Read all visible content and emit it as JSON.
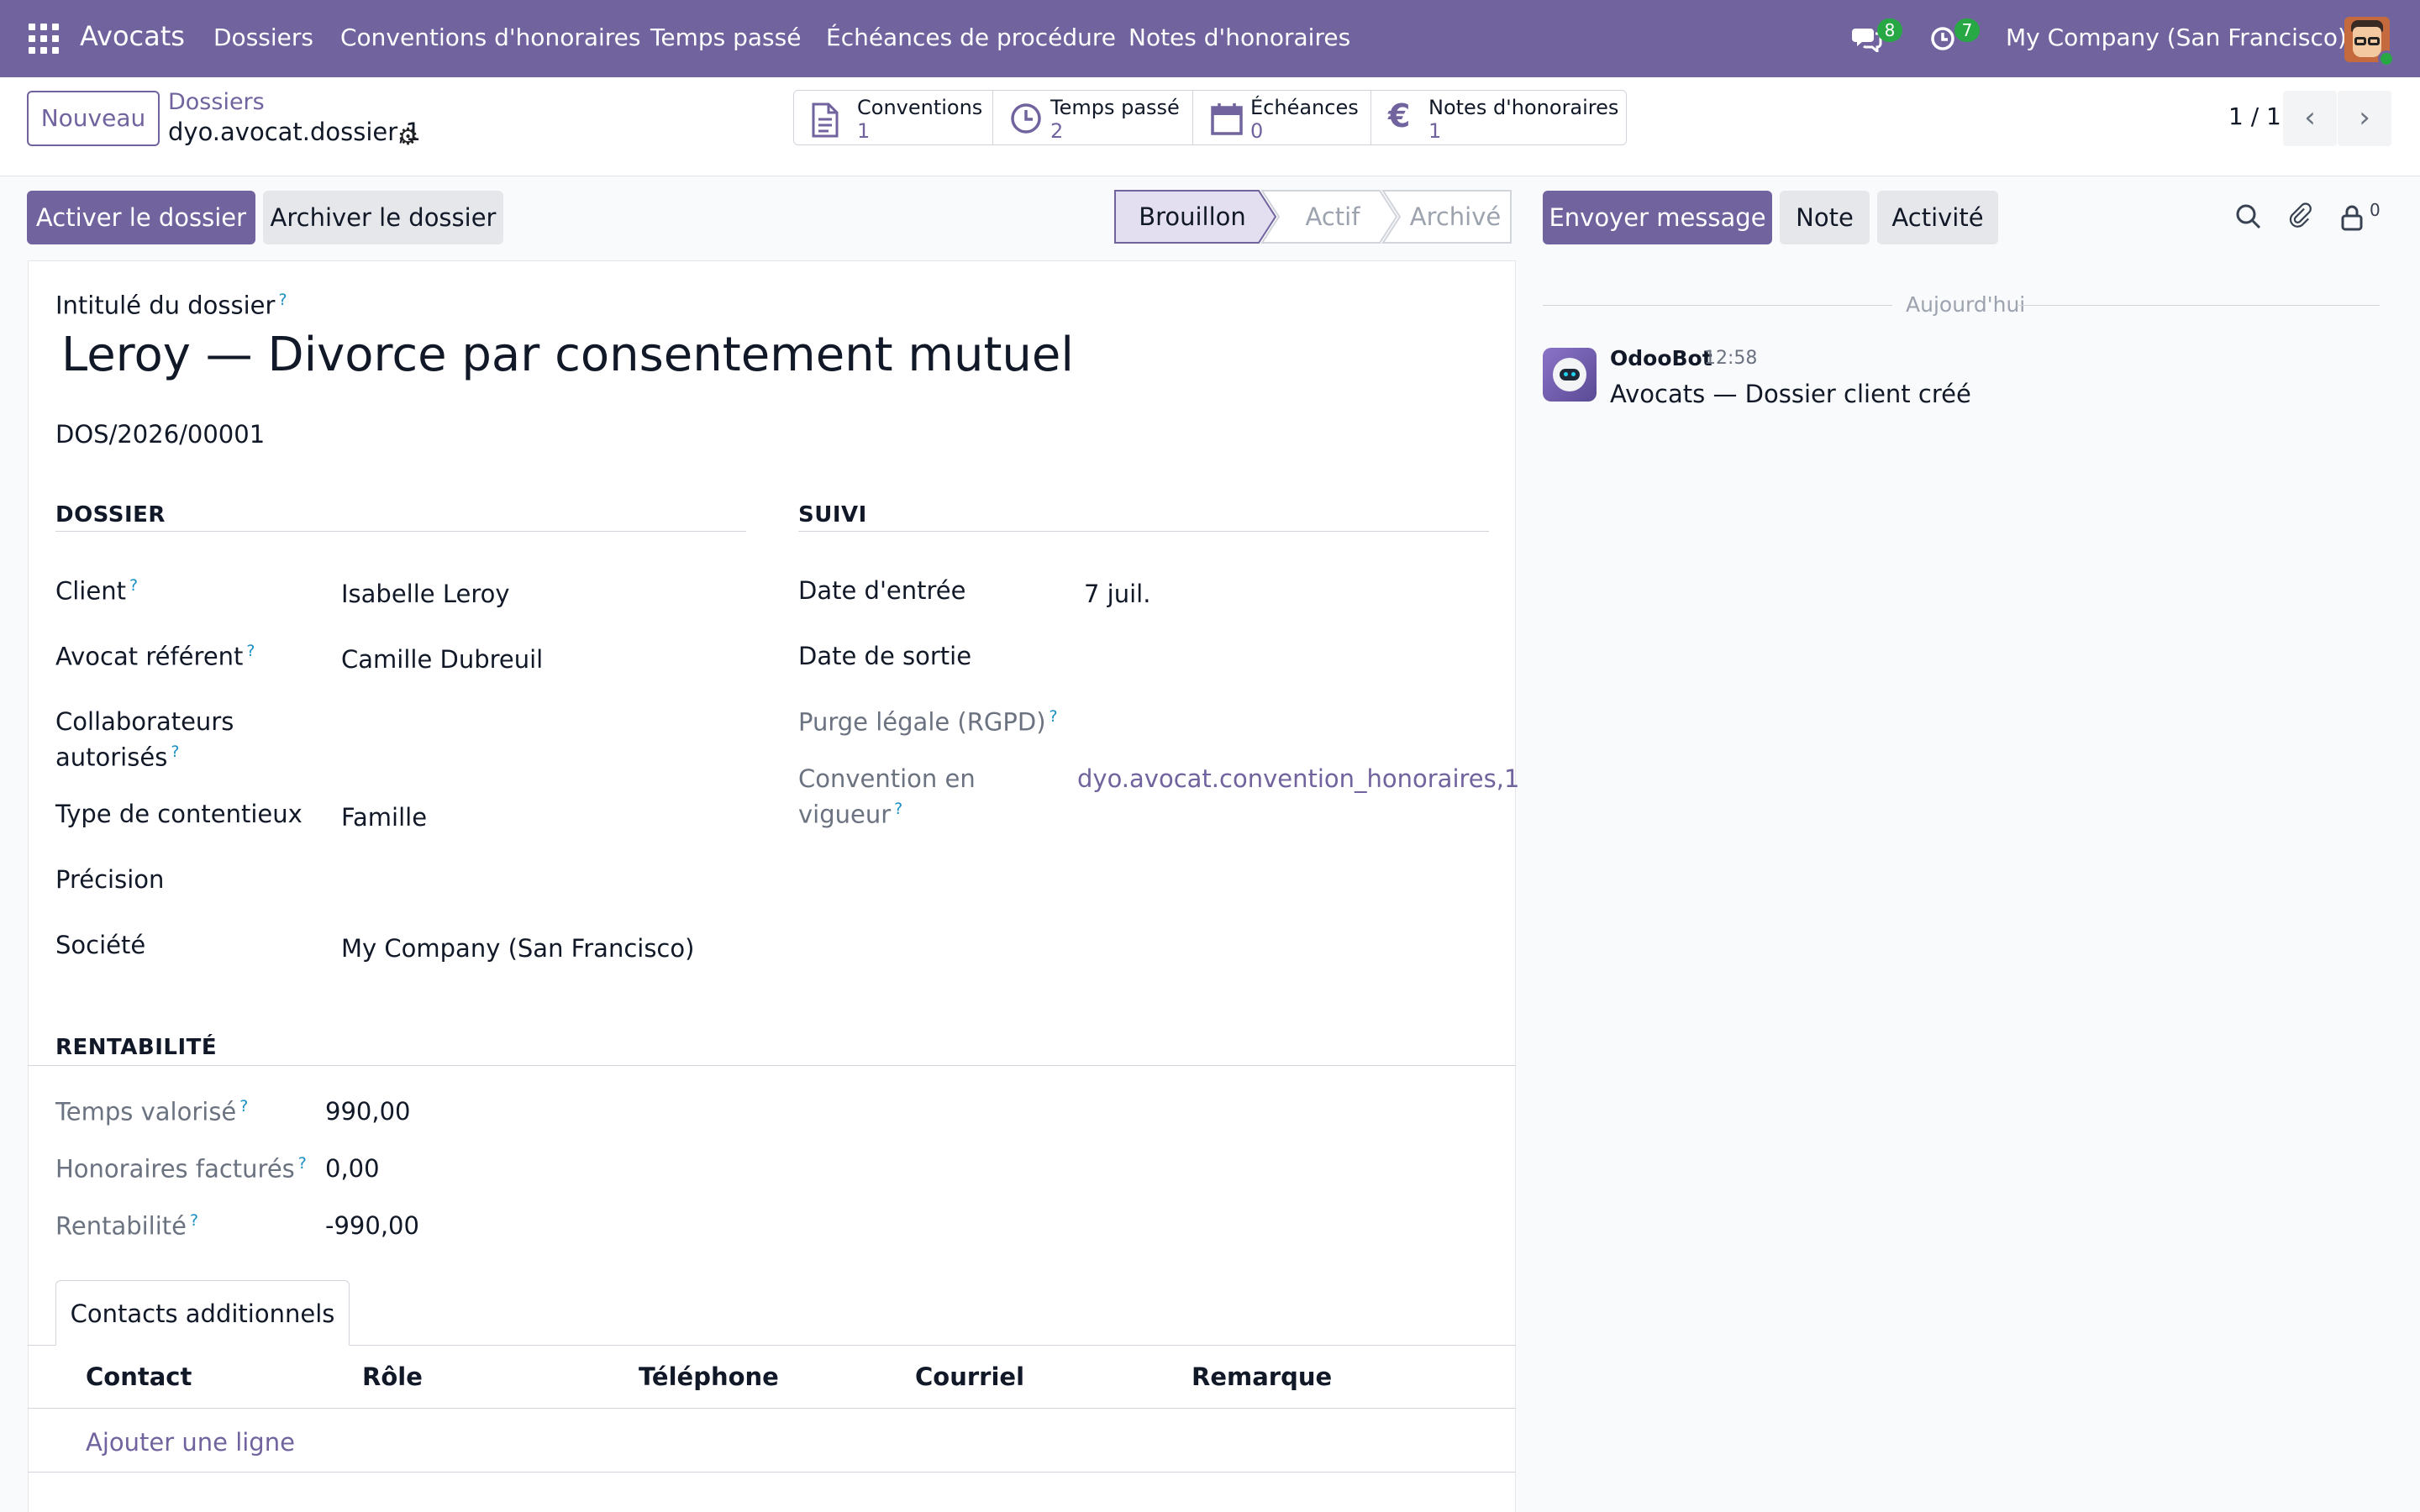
{
  "navbar": {
    "brand": "Avocats",
    "menu": [
      "Dossiers",
      "Conventions d'honoraires",
      "Temps passé",
      "Échéances de procédure",
      "Notes d'honoraires"
    ],
    "messages_badge": "8",
    "activities_badge": "7",
    "company": "My Company (San Francisco)"
  },
  "control": {
    "new_button": "Nouveau",
    "breadcrumb_parent": "Dossiers",
    "breadcrumb_current": "dyo.avocat.dossier,1",
    "smart_buttons": [
      {
        "label": "Conventions",
        "count": "1",
        "icon": "file-icon"
      },
      {
        "label": "Temps passé",
        "count": "2",
        "icon": "clock-icon"
      },
      {
        "label": "Échéances",
        "count": "0",
        "icon": "calendar-icon"
      },
      {
        "label": "Notes d'honoraires",
        "count": "1",
        "icon": "euro-icon"
      }
    ],
    "pager": "1 / 1"
  },
  "statusbar": {
    "activate_button": "Activer le dossier",
    "archive_button": "Archiver le dossier",
    "stages": [
      "Brouillon",
      "Actif",
      "Archivé"
    ],
    "current_stage": "Brouillon"
  },
  "form": {
    "name_label": "Intitulé du dossier",
    "name": "Leroy — Divorce par consentement mutuel",
    "reference": "DOS/2026/00001",
    "dossier_section": "DOSSIER",
    "suivi_section": "SUIVI",
    "client_label": "Client",
    "client": "Isabelle Leroy",
    "lawyer_label": "Avocat référent",
    "lawyer": "Camille Dubreuil",
    "collaborators_label_1": "Collaborateurs",
    "collaborators_label_2": "autorisés",
    "type_label": "Type de contentieux",
    "type": "Famille",
    "precision_label": "Précision",
    "company_label": "Société",
    "company": "My Company (San Francisco)",
    "entry_date_label": "Date d'entrée",
    "entry_date": "7 juil.",
    "exit_date_label": "Date de sortie",
    "purge_label": "Purge légale (RGPD)",
    "convention_label_1": "Convention en",
    "convention_label_2": "vigueur",
    "convention": "dyo.avocat.convention_honoraires,1",
    "profit_section": "RENTABILITÉ",
    "time_value_label": "Temps valorisé",
    "time_value": "990,00",
    "fees_label": "Honoraires facturés",
    "fees": "0,00",
    "profit_label": "Rentabilité",
    "profit": "-990,00",
    "tab": "Contacts additionnels",
    "columns": [
      "Contact",
      "Rôle",
      "Téléphone",
      "Courriel",
      "Remarque"
    ],
    "add_line": "Ajouter une ligne"
  },
  "chatter": {
    "send_message": "Envoyer message",
    "note": "Note",
    "activity": "Activité",
    "followers_count": "0",
    "date_separator": "Aujourd'hui",
    "message": {
      "author": "OdooBot",
      "time": "12:58",
      "body": "Avocats — Dossier client créé"
    }
  },
  "colors": {
    "brand": "#71639e",
    "badge": "#28a745",
    "help": "#1a8fc4"
  }
}
